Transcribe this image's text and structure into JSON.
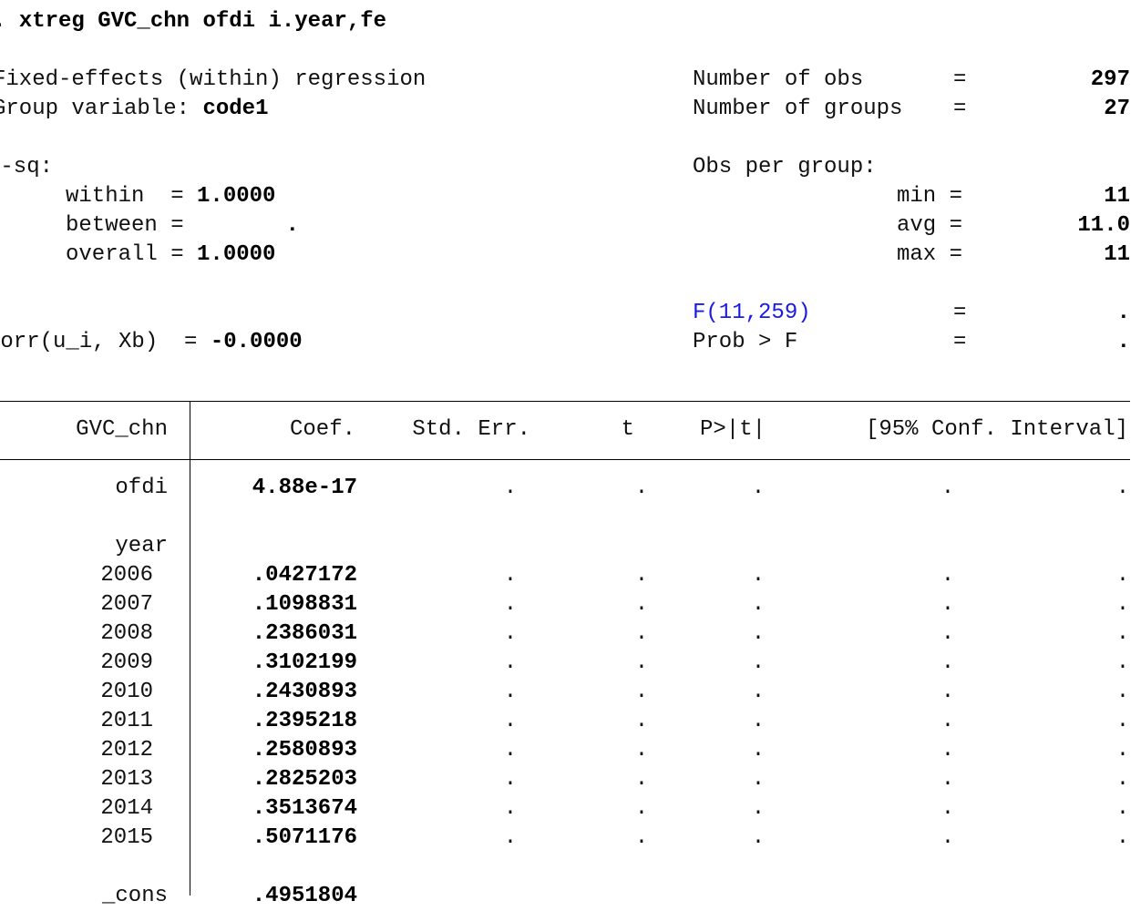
{
  "command": {
    "prompt": ".",
    "text": "xtreg GVC_chn ofdi i.year,fe"
  },
  "header": {
    "model_title": "Fixed-effects (within) regression",
    "group_variable_label": "Group variable:",
    "group_variable_value": "code1",
    "nobs_label": "Number of obs",
    "nobs_value": "297",
    "ngroups_label": "Number of groups",
    "ngroups_value": "27",
    "rsq_label": "R-sq:",
    "rsq_within_label": "within  =",
    "rsq_within_value": "1.0000",
    "rsq_between_label": "between =",
    "rsq_between_value": ".",
    "rsq_overall_label": "overall =",
    "rsq_overall_value": "1.0000",
    "obs_per_group_label": "Obs per group:",
    "min_label": "min =",
    "min_value": "11",
    "avg_label": "avg =",
    "avg_value": "11.0",
    "max_label": "max =",
    "max_value": "11",
    "ftest_label": "F(11,259)",
    "ftest_value": ".",
    "prob_label": "Prob > F",
    "prob_value": ".",
    "corr_label": "corr(u_i, Xb)  =",
    "corr_value": "-0.0000",
    "eq": "="
  },
  "table": {
    "depvar": "GVC_chn",
    "columns": [
      "Coef.",
      "Std. Err.",
      "t",
      "P>|t|",
      "[95% Conf. Interval]"
    ],
    "ofdi_label": "ofdi",
    "ofdi_coef": "4.88e-17",
    "year_label": "year",
    "rows": [
      {
        "label": "2006",
        "coef": ".0427172"
      },
      {
        "label": "2007",
        "coef": ".1098831"
      },
      {
        "label": "2008",
        "coef": ".2386031"
      },
      {
        "label": "2009",
        "coef": ".3102199"
      },
      {
        "label": "2010",
        "coef": ".2430893"
      },
      {
        "label": "2011",
        "coef": ".2395218"
      },
      {
        "label": "2012",
        "coef": ".2580893"
      },
      {
        "label": "2013",
        "coef": ".2825203"
      },
      {
        "label": "2014",
        "coef": ".3513674"
      },
      {
        "label": "2015",
        "coef": ".5071176"
      }
    ],
    "cons_label": "_cons",
    "cons_coef": ".4951804",
    "missing": "."
  },
  "colors": {
    "text": "#111111",
    "link": "#1a1ae6",
    "background": "#ffffff"
  }
}
